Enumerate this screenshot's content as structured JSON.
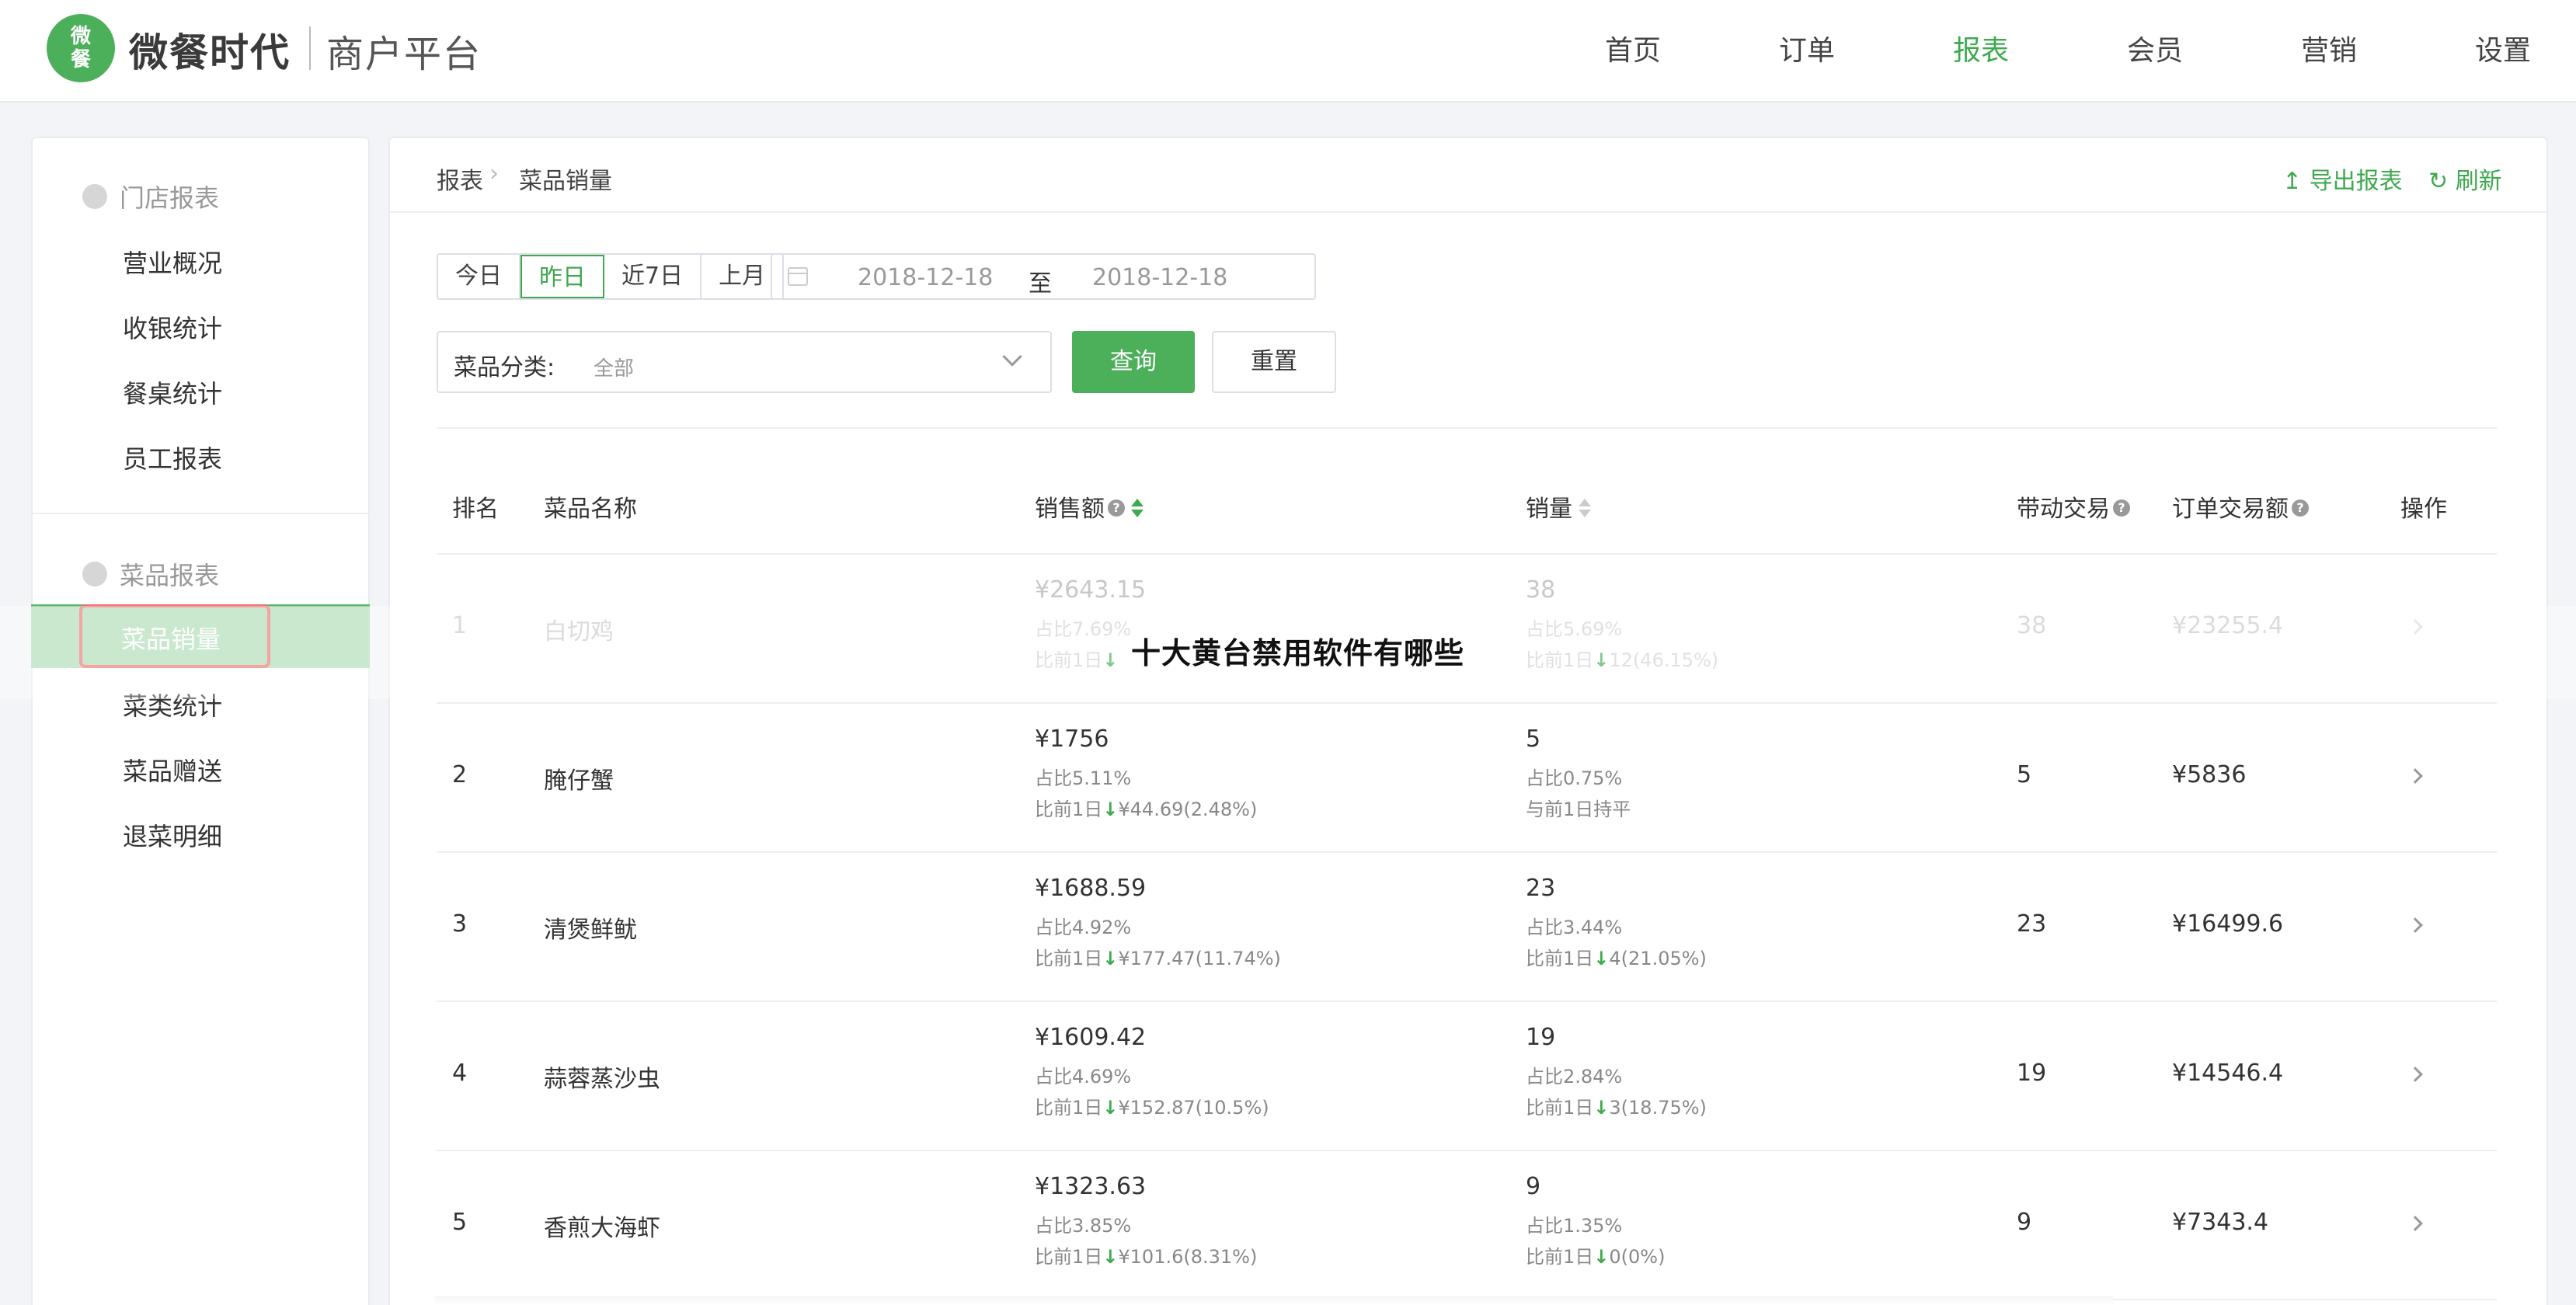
{
  "header": {
    "logo_lines": [
      "微",
      "餐"
    ],
    "brand": "微餐时代",
    "platform": "商户平台",
    "nav": [
      "首页",
      "订单",
      "报表",
      "会员",
      "营销",
      "设置"
    ],
    "active_nav": "报表",
    "accent_color": "#3ea94f"
  },
  "sidebar": {
    "groups": [
      {
        "title": "门店报表",
        "items": [
          "营业概况",
          "收银统计",
          "餐桌统计",
          "员工报表"
        ]
      },
      {
        "title": "菜品报表",
        "items": [
          "菜品销量",
          "菜类统计",
          "菜品赠送",
          "退菜明细"
        ]
      }
    ],
    "active_item": "菜品销量"
  },
  "main": {
    "breadcrumb": [
      "报表",
      "菜品销量"
    ],
    "breadcrumb_sep": "›",
    "export_label": "导出报表",
    "refresh_label": "刷新",
    "date_buttons": [
      "今日",
      "昨日",
      "近7日",
      "上月"
    ],
    "active_date_button": "昨日",
    "date_start": "2018-12-18",
    "date_to": "至",
    "date_end": "2018-12-18",
    "category_label": "菜品分类:",
    "category_value": "全部",
    "query_label": "查询",
    "reset_label": "重置"
  },
  "table": {
    "columns": [
      "排名",
      "菜品名称",
      "销售额",
      "销量",
      "带动交易",
      "订单交易额",
      "操作"
    ],
    "rows": [
      {
        "rank": "1",
        "name": "白切鸡",
        "sales": "¥2643.15",
        "sales_share": "占比7.69%",
        "sales_cmp": "比前1日",
        "sales_cmp_arrow": "↓",
        "sales_cmp_val": "",
        "qty": "38",
        "qty_share": "占比5.69%",
        "qty_cmp": "比前1日",
        "qty_cmp_arrow": "↓",
        "qty_cmp_val": "12(46.15%)",
        "driven": "38",
        "order_amount": "¥23255.4"
      },
      {
        "rank": "2",
        "name": "腌仔蟹",
        "sales": "¥1756",
        "sales_share": "占比5.11%",
        "sales_cmp": "比前1日",
        "sales_cmp_arrow": "↓",
        "sales_cmp_val": "¥44.69(2.48%)",
        "qty": "5",
        "qty_share": "占比0.75%",
        "qty_cmp": "与前1日持平",
        "qty_cmp_arrow": "",
        "qty_cmp_val": "",
        "driven": "5",
        "order_amount": "¥5836"
      },
      {
        "rank": "3",
        "name": "清煲鲜鱿",
        "sales": "¥1688.59",
        "sales_share": "占比4.92%",
        "sales_cmp": "比前1日",
        "sales_cmp_arrow": "↓",
        "sales_cmp_val": "¥177.47(11.74%)",
        "qty": "23",
        "qty_share": "占比3.44%",
        "qty_cmp": "比前1日",
        "qty_cmp_arrow": "↓",
        "qty_cmp_val": "4(21.05%)",
        "driven": "23",
        "order_amount": "¥16499.6"
      },
      {
        "rank": "4",
        "name": "蒜蓉蒸沙虫",
        "sales": "¥1609.42",
        "sales_share": "占比4.69%",
        "sales_cmp": "比前1日",
        "sales_cmp_arrow": "↓",
        "sales_cmp_val": "¥152.87(10.5%)",
        "qty": "19",
        "qty_share": "占比2.84%",
        "qty_cmp": "比前1日",
        "qty_cmp_arrow": "↓",
        "qty_cmp_val": "3(18.75%)",
        "driven": "19",
        "order_amount": "¥14546.4"
      },
      {
        "rank": "5",
        "name": "香煎大海虾",
        "sales": "¥1323.63",
        "sales_share": "占比3.85%",
        "sales_cmp": "比前1日",
        "sales_cmp_arrow": "↓",
        "sales_cmp_val": "¥101.6(8.31%)",
        "qty": "9",
        "qty_share": "占比1.35%",
        "qty_cmp": "比前1日",
        "qty_cmp_arrow": "↓",
        "qty_cmp_val": "0(0%)",
        "driven": "9",
        "order_amount": "¥7343.4"
      }
    ]
  },
  "overlay_text": "十大黄台禁用软件有哪些"
}
